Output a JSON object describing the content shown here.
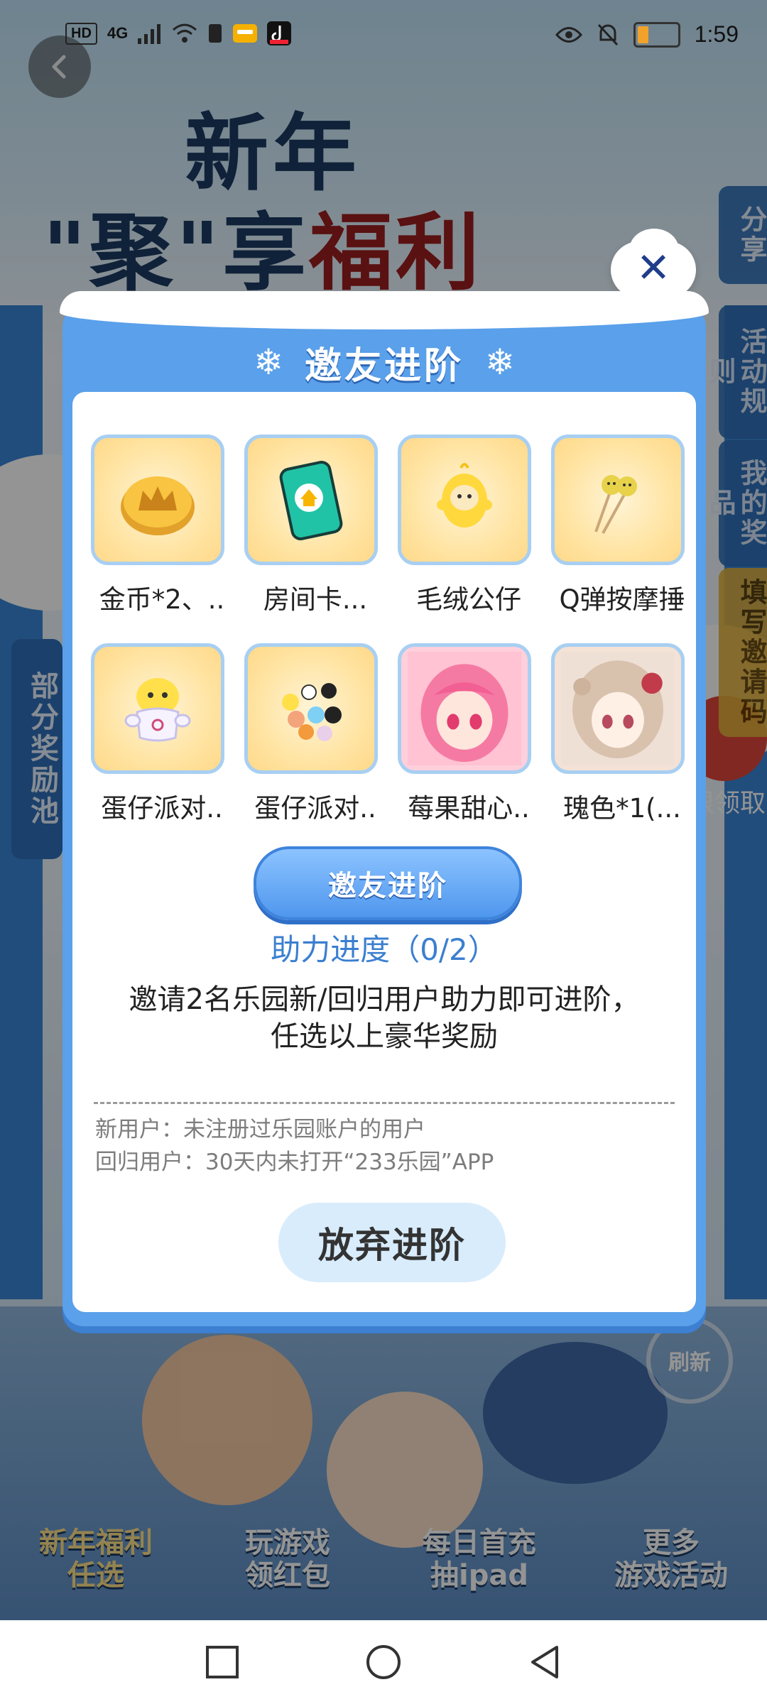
{
  "status_bar": {
    "left_chips": [
      "HD",
      "4G"
    ],
    "time": "1:59"
  },
  "background": {
    "title_line1": "新年",
    "title_line2_prefix": "\"聚\"享",
    "title_line2_highlight": "福利",
    "side_tabs": [
      "分享",
      "活动规则",
      "我的奖品",
      "填写邀请码"
    ],
    "left_tab": "部分奖励池",
    "right_limit": "限领取",
    "refresh": "刷新",
    "bottom_nav": [
      {
        "line1": "新年福利",
        "line2": "任选"
      },
      {
        "line1": "玩游戏",
        "line2": "领红包"
      },
      {
        "line1": "每日首充",
        "line2": "抽ipad"
      },
      {
        "line1": "更多",
        "line2": "游戏活动"
      }
    ]
  },
  "modal": {
    "title": "邀友进阶",
    "close_label": "✕",
    "prizes": [
      {
        "name": "金币*2、..",
        "icon": "gold-coin-crown-icon"
      },
      {
        "name": "房间卡...",
        "icon": "room-card-icon"
      },
      {
        "name": "毛绒公仔",
        "icon": "plush-doll-icon"
      },
      {
        "name": "Q弹按摩捶",
        "icon": "massage-hammer-icon"
      },
      {
        "name": "蛋仔派对..",
        "icon": "eggy-party-plush-icon"
      },
      {
        "name": "蛋仔派对..",
        "icon": "eggy-party-figures-icon"
      },
      {
        "name": "莓果甜心..",
        "icon": "berry-girl-avatar"
      },
      {
        "name": "瑰色*1(...",
        "icon": "rose-girl-avatar"
      }
    ],
    "cta_label": "邀友进阶",
    "progress_text": "助力进度（0/2）",
    "description_line1": "邀请2名乐园新/回归用户助力即可进阶，",
    "description_line2": "任选以上豪华奖励",
    "note_line1": "新用户：未注册过乐园账户的用户",
    "note_line2": "回归用户：30天内未打开“233乐园”APP",
    "giveup_label": "放弃进阶"
  },
  "colors": {
    "modal_blue": "#5aa0ea",
    "cta_blue": "#4f97ee",
    "progress_text": "#3b7fd0",
    "giveup_bg": "#d8ecfc"
  }
}
